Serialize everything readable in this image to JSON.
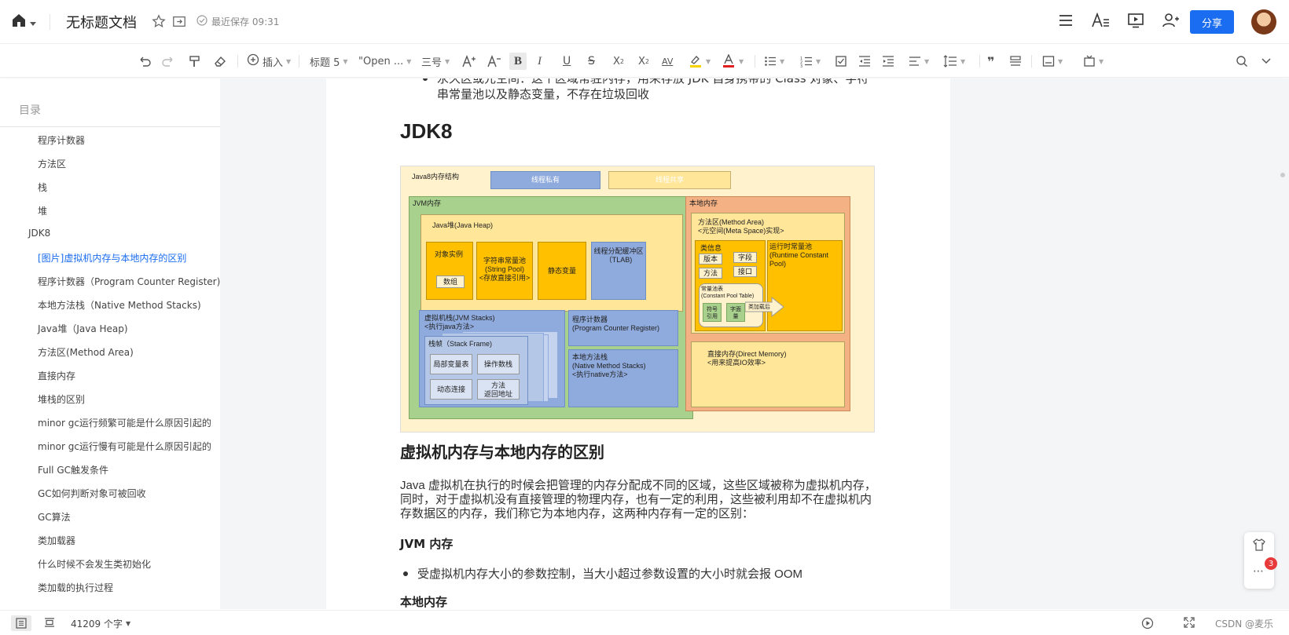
{
  "header": {
    "doc_title": "无标题文档",
    "save_status": "最近保存 09:31",
    "share_label": "分享"
  },
  "toolbar": {
    "insert_label": "插入",
    "heading_label": "标题 5",
    "font_label": "\"Open ...",
    "size_label": "三号"
  },
  "toc": {
    "heading": "目录",
    "items": [
      {
        "label": "程序计数器",
        "level": 2
      },
      {
        "label": "方法区",
        "level": 2
      },
      {
        "label": "栈",
        "level": 2
      },
      {
        "label": "堆",
        "level": 2
      },
      {
        "label": "JDK8",
        "level": 1
      },
      {
        "label": "[图片]虚拟机内存与本地内存的区别",
        "level": 2,
        "active": true
      },
      {
        "label": "程序计数器（Program Counter Register)",
        "level": 2
      },
      {
        "label": "本地方法栈（Native Method Stacks)",
        "level": 2
      },
      {
        "label": "Java堆（Java Heap)",
        "level": 2
      },
      {
        "label": "方法区(Method Area)",
        "level": 2
      },
      {
        "label": "直接内存",
        "level": 2
      },
      {
        "label": "堆栈的区别",
        "level": 2
      },
      {
        "label": "minor gc运行频繁可能是什么原因引起的",
        "level": 2
      },
      {
        "label": "minor gc运行慢有可能是什么原因引起的",
        "level": 2
      },
      {
        "label": "Full GC触发条件",
        "level": 2
      },
      {
        "label": "GC如何判断对象可被回收",
        "level": 2
      },
      {
        "label": "GC算法",
        "level": 2
      },
      {
        "label": "类加载器",
        "level": 2
      },
      {
        "label": "什么时候不会发生类初始化",
        "level": 2
      },
      {
        "label": "类加载的执行过程",
        "level": 2
      }
    ]
  },
  "doc": {
    "prev_text": "永久区或元空间：这个区域常驻内存，用来存放 JDK 自身携带的 Class 对象、字符串常量池以及静态变量，不存在垃圾回收",
    "h_jdk8": "JDK8",
    "diagram": {
      "title": "Java8内存结构",
      "legend_private": "线程私有",
      "legend_shared": "线程共享",
      "jvm_memory": "JVM内存",
      "native_memory": "本地内存",
      "java_heap": "Java堆(Java Heap)",
      "object_instance": "对象实例",
      "array": "数组",
      "string_pool": "字符串常量池\n(String Pool)\n<存放直接引用>",
      "static_var": "静态变量",
      "tlab": "线程分配缓冲区\n（TLAB)",
      "jvm_stacks": "虚拟机栈(JVM Stacks)\n<执行java方法>",
      "stack_frame": "栈帧（Stack Frame)",
      "local_vars": "局部变量表",
      "operand_stack": "操作数栈",
      "dynamic_link": "动态连接",
      "return_addr": "方法\n返回地址",
      "pc_register": "程序计数器\n(Program Counter Register)",
      "native_stacks": "本地方法栈\n(Native Method Stacks)\n<执行native方法>",
      "method_area": "方法区(Method Area)\n<元空间(Meta Space)实现>",
      "class_info": "类信息",
      "version": "版本",
      "field": "字段",
      "method": "方法",
      "interface": "接口",
      "const_pool": "常量池表\n(Constant Pool Table)",
      "symbol_ref": "符号\n引用",
      "literal": "字面\n量",
      "after_load": "类加载后",
      "runtime_pool": "运行时常量池\n(Runtime Constant Pool)",
      "direct_memory": "直接内存(Direct Memory)\n<用来提高IO效率>"
    },
    "h2": "虚拟机内存与本地内存的区别",
    "para": "Java 虚拟机在执行的时候会把管理的内存分配成不同的区域，这些区域被称为虚拟机内存，同时，对于虚拟机没有直接管理的物理内存，也有一定的利用，这些被利用却不在虚拟机内存数据区的内存，我们称它为本地内存，这两种内存有一定的区别：",
    "h3_jvm": "JVM 内存",
    "bullet_jvm": "受虚拟机内存大小的参数控制，当大小超过参数设置的大小时就会报 OOM",
    "h3_native": "本地内存"
  },
  "float": {
    "badge": "3"
  },
  "status": {
    "word_count": "41209 个字",
    "watermark": "CSDN @麦乐"
  }
}
